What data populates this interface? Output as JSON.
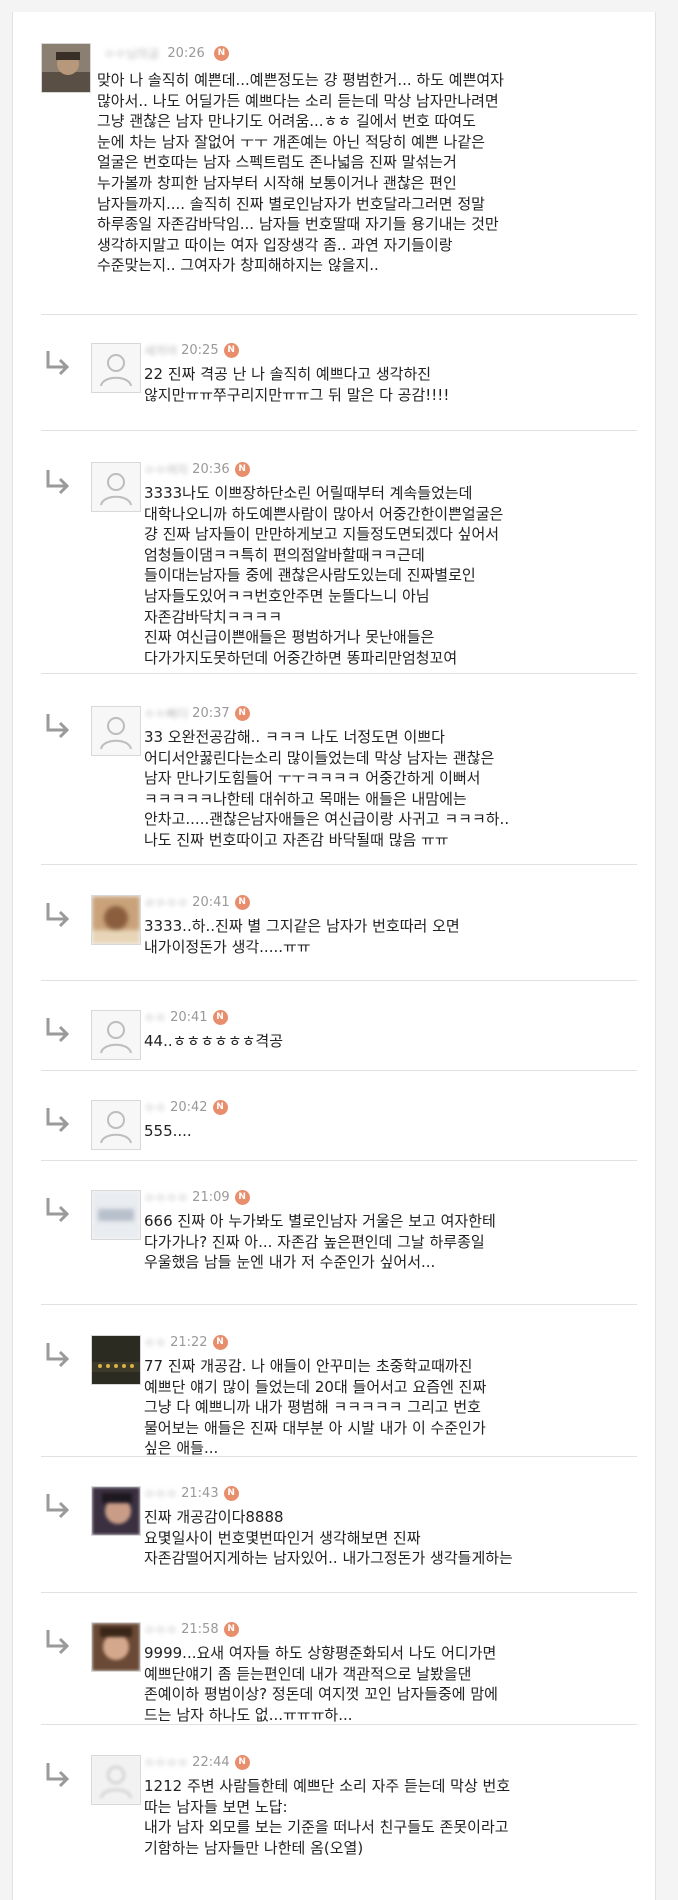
{
  "comments": [
    {
      "name": "ㅇㅇ님의글",
      "time": "20:26",
      "new": "N",
      "reply": false,
      "avatar": "photo",
      "text": "맞아 나 솔직히 예쁜데...예쁜정도는 걍 평범한거... 하도 예쁜여자\n많아서.. 나도 어딜가든 예쁘다는 소리 듣는데 막상 남자만나려면\n그냥 괜찮은 남자 만나기도 어려움...ㅎㅎ 길에서 번호 따여도\n눈에 차는 남자 잘없어 ㅜㅜ 개존예는 아닌 적당히 예쁜 나같은\n얼굴은 번호따는 남자 스펙트럼도 존나넓음 진짜 말섞는거\n누가볼까 창피한 남자부터 시작해 보통이거나 괜찮은 편인\n남자들까지.... 솔직히 진짜 별로인남자가 번호달라그러면 정말\n하루종일 자존감바닥임... 남자들 번호딸때 자기들 용기내는 것만\n생각하지말고 따이는 여자 입장생각 좀.. 과연 자기들이랑\n수준맞는지.. 그여자가 창피해하지는 않을지.."
    },
    {
      "name": "새끼야",
      "time": "20:25",
      "new": "N",
      "reply": true,
      "avatar": "default",
      "text": "22 진짜 격공 난 나 솔직히 예쁘다고 생각하진\n않지만ㅠㅠ쭈구리지만ㅠㅠ그 뒤 말은 다 공감!!!!"
    },
    {
      "name": "ㅇㅇ여자",
      "time": "20:36",
      "new": "N",
      "reply": true,
      "avatar": "default",
      "text": "3333나도 이쁘장하단소린 어릴때부터 계속들었는데\n대학나오니까 하도예쁜사람이 많아서 어중간한이쁜얼굴은\n걍 진짜 남자들이 만만하게보고 지들정도면되겠다 싶어서\n엄청들이댐ㅋㅋ특히 편의점알바할때ㅋㅋ근데\n들이대는남자들 중에 괜찮은사람도있는데 진짜별로인\n남자들도있어ㅋㅋ번호안주면 눈뜰다느니 아님\n자존감바닥치ㅋㅋㅋㅋ\n진짜 여신급이쁜애들은 평범하거나 못난애들은\n다가가지도못하던데 어중간하면 똥파리만엄청꼬여"
    },
    {
      "name": "ㅇㅇ빠더",
      "time": "20:37",
      "new": "N",
      "reply": true,
      "avatar": "default",
      "text": "33 오완전공감해.. ㅋㅋㅋ 나도 너정도면 이쁘다\n어디서안꿇린다는소리 많이들었는데 막상 남자는 괜찮은\n남자 만나기도힘들어 ㅜㅜㅋㅋㅋㅋ 어중간하게 이뻐서\nㅋㅋㅋㅋㅋ나한테 대쉬하고 목매는 애들은 내맘에는\n안차고.....괜찮은남자애들은 여신급이랑 사귀고 ㅋㅋㅋ하..\n나도 진짜 번호따이고 자존감 바닥될때 많음 ㅠㅠ"
    },
    {
      "name": "ㄹㅇㅇㅇ",
      "time": "20:41",
      "new": "N",
      "reply": true,
      "avatar": "photo-brown",
      "text": "3333..하..진짜 별 그지같은 남자가 번호따러 오면\n내가이정돈가 생각.....ㅠㅠ"
    },
    {
      "name": "ㅇㅇ",
      "time": "20:41",
      "new": "N",
      "reply": true,
      "avatar": "default",
      "text": "44..ㅎㅎㅎㅎㅎㅎ격공"
    },
    {
      "name": "ㅇㅇ",
      "time": "20:42",
      "new": "N",
      "reply": true,
      "avatar": "default",
      "text": "555...."
    },
    {
      "name": "ㅇㅇㅇㅇ",
      "time": "21:09",
      "new": "N",
      "reply": true,
      "avatar": "photo-gray",
      "text": "666 진짜 아 누가봐도 별로인남자 거울은 보고 여자한테\n다가가나? 진짜 아... 자존감 높은편인데 그날 하루종일\n우울했음 남들 눈엔 내가 저 수준인가 싶어서..."
    },
    {
      "name": "ㅇㅇ",
      "time": "21:22",
      "new": "N",
      "reply": true,
      "avatar": "photo-dark",
      "text": "77 진짜 개공감. 나 애들이 안꾸미는 초중학교때까진\n예쁘단 얘기 많이 들었는데 20대 들어서고 요즘엔 진짜\n그냥 다 예쁘니까 내가 평범해 ㅋㅋㅋㅋㅋ 그리고 번호\n물어보는 애들은 진짜 대부분 아 시발 내가 이 수준인가\n싶은 애들..."
    },
    {
      "name": "ㅇㅇㅇ",
      "time": "21:43",
      "new": "N",
      "reply": true,
      "avatar": "photo-face",
      "text": "진짜 개공감이다8888\n요몇일사이 번호몇번따인거 생각해보면 진짜\n자존감떨어지게하는 남자있어.. 내가그정돈가 생각들게하는"
    },
    {
      "name": "ㅇㅇㅇ",
      "time": "21:58",
      "new": "N",
      "reply": true,
      "avatar": "photo-face2",
      "text": "9999...요새 여자들 하도 상향평준화되서 나도 어디가면\n예쁘단얘기 좀 듣는편인데 내가 객관적으로 날봤을댄\n존예이하 평범이상? 정돈데 여지껏 꼬인 남자들중에 맘에\n드는 남자 하나도 없...ㅠㅠㅠ하..."
    },
    {
      "name": "ㅇㅇㅇㅇ",
      "time": "22:44",
      "new": "N",
      "reply": true,
      "avatar": "default-blur",
      "text": "1212 주변 사람들한테 예쁘단 소리 자주 듣는데 막상 번호\n따는 남자들 보면 노답:\n내가 남자 외모를 보는 기준을 떠나서 친구들도 존못이라고\n기함하는 남자들만 나한테 옴(오열)"
    }
  ]
}
